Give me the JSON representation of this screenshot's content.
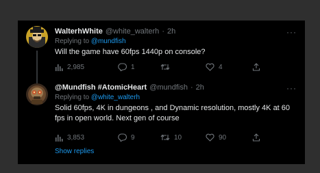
{
  "tweets": [
    {
      "name": "WalterhWhite",
      "handle": "@white_walterh",
      "dot": "·",
      "time": "2h",
      "replying_prefix": "Replying to",
      "replying_to": "@mundfish",
      "text": "Will the game have 60fps 1440p on console?",
      "views": "2,985",
      "replies": "1",
      "retweets": "",
      "likes": "4",
      "more": "···"
    },
    {
      "name": "@Mundfish #AtomicHeart",
      "handle": "@mundfish",
      "dot": "·",
      "time": "2h",
      "replying_prefix": "Replying to",
      "replying_to": "@white_walterh",
      "text": "Solid 60fps, 4K in dungeons , and  Dynamic resolution, mostly 4K at 60 fps in open world. Next gen of course",
      "views": "3,853",
      "replies": "9",
      "retweets": "10",
      "likes": "90",
      "more": "···"
    }
  ],
  "show_replies": "Show replies",
  "icons": {
    "views": "bar-chart-icon",
    "reply": "comment-icon",
    "retweet": "retweet-icon",
    "like": "heart-icon",
    "share": "share-icon"
  },
  "colors": {
    "background": "#000000",
    "text": "#e7e9ea",
    "muted": "#71767b",
    "link": "#1d9bf0"
  }
}
